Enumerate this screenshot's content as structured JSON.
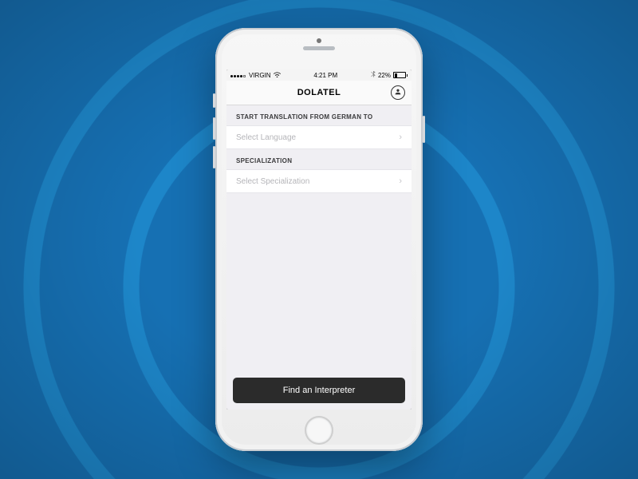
{
  "status_bar": {
    "carrier": "VIRGIN",
    "time": "4:21 PM",
    "battery_text": "22%"
  },
  "nav": {
    "title": "DOLATEL"
  },
  "form": {
    "section_language_label": "START TRANSLATION FROM GERMAN TO",
    "select_language_placeholder": "Select Language",
    "section_specialization_label": "SPECIALIZATION",
    "select_specialization_placeholder": "Select Specialization"
  },
  "primary_button_label": "Find an Interpreter"
}
